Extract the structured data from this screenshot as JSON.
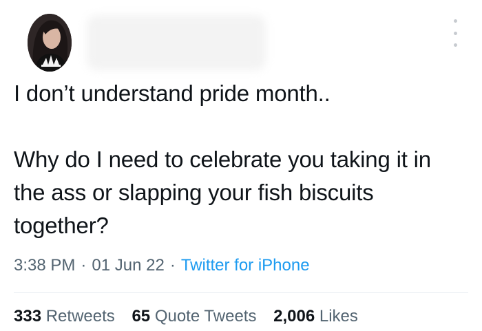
{
  "tweet": {
    "line1": "I don’t understand pride month..",
    "line2": "Why do I need to celebrate you taking it in the ass or slapping your fish biscuits together?",
    "time": "3:38 PM",
    "date": "01 Jun 22",
    "source": "Twitter for iPhone",
    "separator": "·"
  },
  "stats": {
    "retweets_count": "333",
    "retweets_label": "Retweets",
    "quotes_count": "65",
    "quotes_label": "Quote Tweets",
    "likes_count": "2,006",
    "likes_label": "Likes"
  },
  "icons": {
    "more": "more-options-icon",
    "avatar": "avatar"
  },
  "colors": {
    "text": "#0f1419",
    "secondary": "#536471",
    "link": "#1d9bf0",
    "divider": "#e6ecf0"
  }
}
